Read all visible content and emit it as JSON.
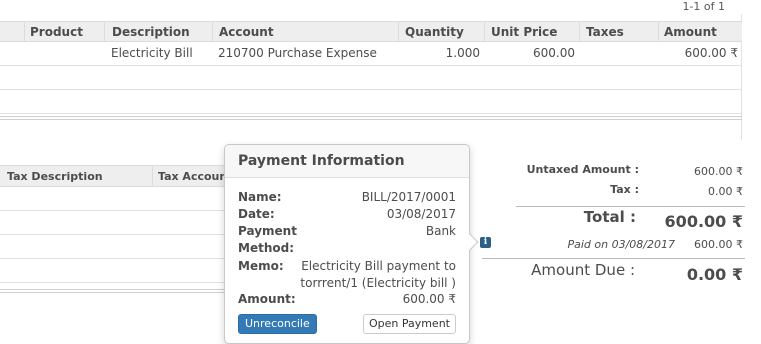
{
  "pager": "1-1 of 1",
  "lines_table": {
    "headers": {
      "product": "Product",
      "description": "Description",
      "account": "Account",
      "quantity": "Quantity",
      "unit_price": "Unit Price",
      "taxes": "Taxes",
      "amount": "Amount"
    },
    "rows": [
      {
        "product": "",
        "description": "Electricity Bill",
        "account": "210700 Purchase Expense",
        "quantity": "1.000",
        "unit_price": "600.00",
        "taxes": "",
        "amount": "600.00 ₹"
      }
    ]
  },
  "tax_table": {
    "headers": {
      "description": "Tax Description",
      "account": "Tax Account"
    }
  },
  "totals": {
    "untaxed_label": "Untaxed Amount :",
    "untaxed_value": "600.00 ₹",
    "tax_label": "Tax :",
    "tax_value": "0.00 ₹",
    "total_label": "Total :",
    "total_value": "600.00 ₹",
    "paid_label": "Paid on 03/08/2017",
    "paid_value": "600.00 ₹",
    "due_label": "Amount Due :",
    "due_value": "0.00 ₹"
  },
  "popover": {
    "title": "Payment Information",
    "name_label": "Name:",
    "name_value": "BILL/2017/0001",
    "date_label": "Date:",
    "date_value": "03/08/2017",
    "method_label_1": "Payment",
    "method_label_2": "Method:",
    "method_value": "Bank",
    "memo_label": "Memo:",
    "memo_line_1": "Electricity Bill payment to",
    "memo_line_2": "torrrent/1 (Electricity bill )",
    "amount_label": "Amount:",
    "amount_value": "600.00 ₹",
    "unreconcile_label": "Unreconcile",
    "open_payment_label": "Open Payment"
  },
  "info_icon": "info-icon",
  "colors": {
    "primary_button": "#337ab7",
    "header_bg": "#eeeeee",
    "info_icon": "#2b5f87"
  }
}
